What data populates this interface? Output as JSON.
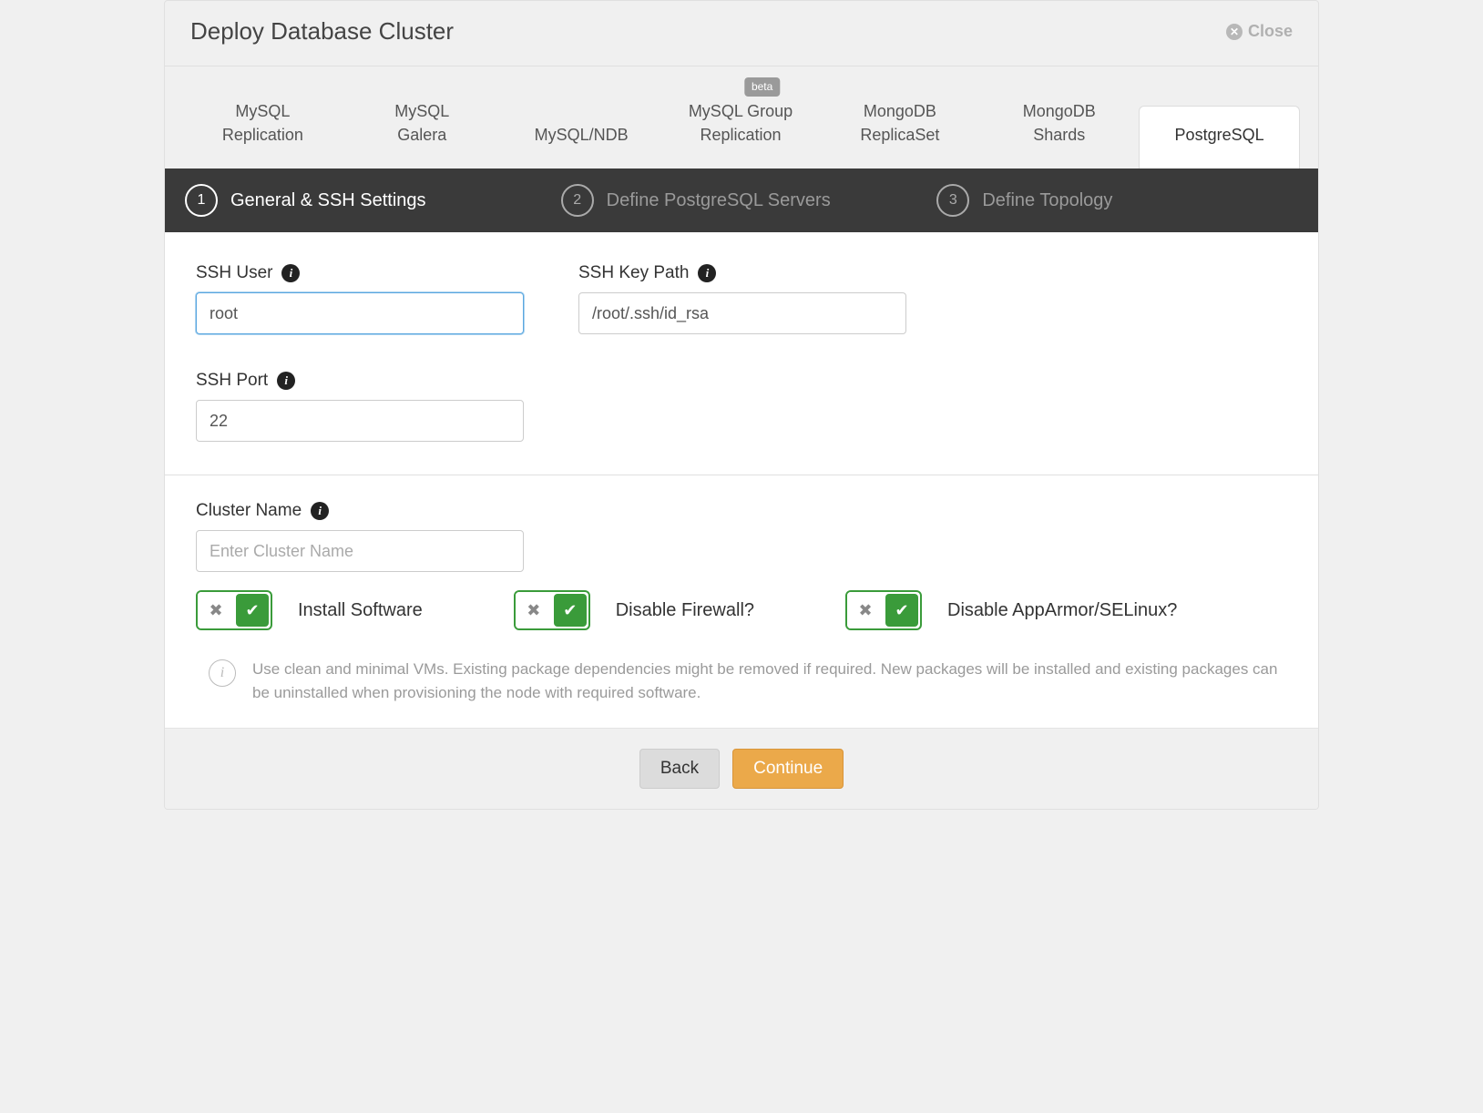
{
  "modal": {
    "title": "Deploy Database Cluster",
    "close_label": "Close"
  },
  "db_tabs": [
    {
      "line1": "MySQL",
      "line2": "Replication",
      "beta": false,
      "active": false
    },
    {
      "line1": "MySQL",
      "line2": "Galera",
      "beta": false,
      "active": false
    },
    {
      "line1": "MySQL/NDB",
      "line2": "",
      "beta": false,
      "active": false
    },
    {
      "line1": "MySQL Group",
      "line2": "Replication",
      "beta": true,
      "active": false
    },
    {
      "line1": "MongoDB",
      "line2": "ReplicaSet",
      "beta": false,
      "active": false
    },
    {
      "line1": "MongoDB",
      "line2": "Shards",
      "beta": false,
      "active": false
    },
    {
      "line1": "PostgreSQL",
      "line2": "",
      "beta": false,
      "active": true
    }
  ],
  "beta_badge": "beta",
  "steps": [
    {
      "num": "1",
      "label": "General & SSH Settings",
      "active": true
    },
    {
      "num": "2",
      "label": "Define PostgreSQL Servers",
      "active": false
    },
    {
      "num": "3",
      "label": "Define Topology",
      "active": false
    }
  ],
  "fields": {
    "ssh_user": {
      "label": "SSH User",
      "value": "root"
    },
    "ssh_key_path": {
      "label": "SSH Key Path",
      "value": "/root/.ssh/id_rsa"
    },
    "ssh_port": {
      "label": "SSH Port",
      "value": "22"
    },
    "cluster_name": {
      "label": "Cluster Name",
      "value": "",
      "placeholder": "Enter Cluster Name"
    }
  },
  "toggles": {
    "install_software": {
      "label": "Install Software",
      "on": true
    },
    "disable_firewall": {
      "label": "Disable Firewall?",
      "on": true
    },
    "disable_apparmor": {
      "label": "Disable AppArmor/SELinux?",
      "on": true
    }
  },
  "info_text": "Use clean and minimal VMs. Existing package dependencies might be removed if required. New packages will be installed and existing packages can be uninstalled when provisioning the node with required software.",
  "buttons": {
    "back": "Back",
    "continue": "Continue"
  }
}
